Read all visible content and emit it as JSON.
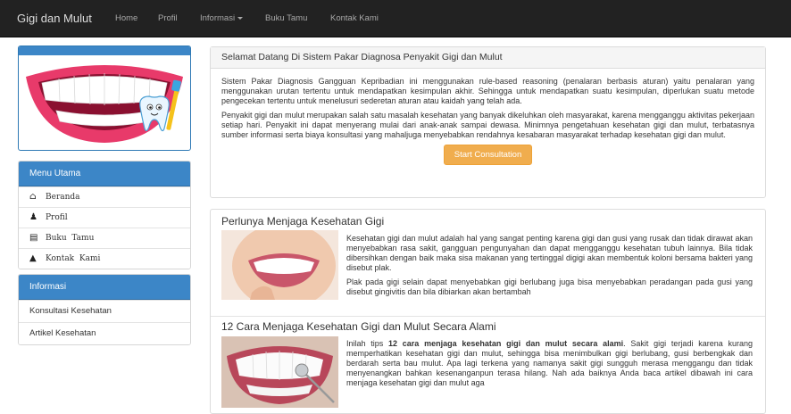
{
  "navbar": {
    "brand": "Gigi dan Mulut",
    "items": [
      {
        "label": "Home"
      },
      {
        "label": "Profil"
      },
      {
        "label": "Informasi"
      },
      {
        "label": "Buku Tamu"
      },
      {
        "label": "Kontak Kami"
      }
    ]
  },
  "sidebar": {
    "menu_title": "Menu Utama",
    "menu_items": [
      {
        "label": "Beranda",
        "icon": "home-icon"
      },
      {
        "label": "Profil",
        "icon": "user-icon"
      },
      {
        "label": "Buku  Tamu",
        "icon": "card-icon"
      },
      {
        "label": "Kontak  Kami",
        "icon": "contact-icon"
      }
    ],
    "info_title": "Informasi",
    "info_items": [
      {
        "label": "Konsultasi Kesehatan"
      },
      {
        "label": "Artikel Kesehatan"
      }
    ]
  },
  "welcome": {
    "title": "Selamat Datang Di Sistem Pakar Diagnosa Penyakit Gigi dan Mulut",
    "paragraph1": "Sistem Pakar Diagnosis Gangguan Kepribadian ini menggunakan rule-based reasoning (penalaran berbasis aturan) yaitu penalaran yang menggunakan urutan tertentu untuk mendapatkan kesimpulan akhir. Sehingga untuk mendapatkan suatu kesimpulan, diperlukan suatu metode pengecekan tertentu untuk menelusuri sederetan aturan atau kaidah yang telah ada.",
    "paragraph2": "Penyakit gigi dan mulut merupakan salah satu masalah kesehatan yang banyak dikeluhkan oleh masyarakat, karena mengganggu aktivitas pekerjaan setiap hari. Penyakit ini dapat menyerang mulai dari anak-anak sampai dewasa. Minimnya pengetahuan kesehatan gigi dan mulut, terbatasnya sumber informasi serta biaya konsultasi yang mahaljuga menyebabkan rendahnya kesabaran masyarakat terhadap kesehatan gigi dan mulut.",
    "button": "Start Consultation"
  },
  "articles": [
    {
      "title": "Perlunya Menjaga Kesehatan Gigi",
      "paragraphs": [
        "Kesehatan gigi dan mulut adalah hal yang sangat penting karena gigi dan gusi yang rusak dan tidak dirawat akan menyebabkan rasa sakit, gangguan pengunyahan dan dapat mengganggu kesehatan tubuh lainnya. Bila tidak dibersihkan dengan baik maka sisa makanan yang tertinggal digigi akan membentuk koloni bersama bakteri yang disebut plak.",
        "Plak pada gigi selain dapat menyebabkan gigi berlubang juga bisa menyebabkan peradangan pada gusi yang disebut gingivitis dan bila dibiarkan akan bertambah"
      ]
    },
    {
      "title": "12 Cara Menjaga Kesehatan Gigi dan Mulut Secara Alami",
      "intro": "Inilah tips ",
      "bold": "12 cara menjaga kesehatan gigi dan mulut secara alami",
      "rest": ". Sakit gigi terjadi karena kurang memperhatikan kesehatan gigi dan mulut, sehingga bisa menimbulkan gigi berlubang, gusi berbengkak dan berdarah serta bau mulut. Apa lagi terkena yang namanya sakit gigi sungguh merasa menggangu dan tidak menyenangkan bahkan kesenanganpun terasa hilang. Nah ada baiknya Anda baca artikel dibawah ini cara menjaga kesehatan gigi dan mulut aga"
    }
  ],
  "colors": {
    "navbar": "#222222",
    "panel_primary": "#3c86c7",
    "button_warning": "#f0ad4e"
  }
}
